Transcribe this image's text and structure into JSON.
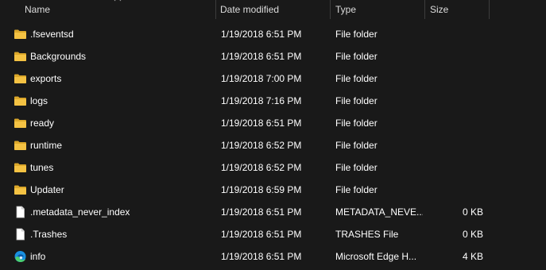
{
  "columns": {
    "name": "Name",
    "date": "Date modified",
    "type": "Type",
    "size": "Size"
  },
  "files": [
    {
      "name": ".fseventsd",
      "date": "1/19/2018 6:51 PM",
      "type": "File folder",
      "size": "",
      "icon": "folder-icon"
    },
    {
      "name": "Backgrounds",
      "date": "1/19/2018 6:51 PM",
      "type": "File folder",
      "size": "",
      "icon": "folder-icon"
    },
    {
      "name": "exports",
      "date": "1/19/2018 7:00 PM",
      "type": "File folder",
      "size": "",
      "icon": "folder-icon"
    },
    {
      "name": "logs",
      "date": "1/19/2018 7:16 PM",
      "type": "File folder",
      "size": "",
      "icon": "folder-icon"
    },
    {
      "name": "ready",
      "date": "1/19/2018 6:51 PM",
      "type": "File folder",
      "size": "",
      "icon": "folder-icon"
    },
    {
      "name": "runtime",
      "date": "1/19/2018 6:52 PM",
      "type": "File folder",
      "size": "",
      "icon": "folder-icon"
    },
    {
      "name": "tunes",
      "date": "1/19/2018 6:52 PM",
      "type": "File folder",
      "size": "",
      "icon": "folder-icon"
    },
    {
      "name": "Updater",
      "date": "1/19/2018 6:59 PM",
      "type": "File folder",
      "size": "",
      "icon": "folder-icon"
    },
    {
      "name": ".metadata_never_index",
      "date": "1/19/2018 6:51 PM",
      "type": "METADATA_NEVE...",
      "size": "0 KB",
      "icon": "file-icon"
    },
    {
      "name": ".Trashes",
      "date": "1/19/2018 6:51 PM",
      "type": "TRASHES File",
      "size": "0 KB",
      "icon": "file-icon"
    },
    {
      "name": "info",
      "date": "1/19/2018 6:51 PM",
      "type": "Microsoft Edge H...",
      "size": "4 KB",
      "icon": "edge-icon"
    }
  ],
  "colors": {
    "background": "#191919",
    "text": "#ffffff",
    "header_text": "#dcdcdc",
    "folder_yellow": "#f4c243",
    "folder_dark": "#dba72a"
  }
}
